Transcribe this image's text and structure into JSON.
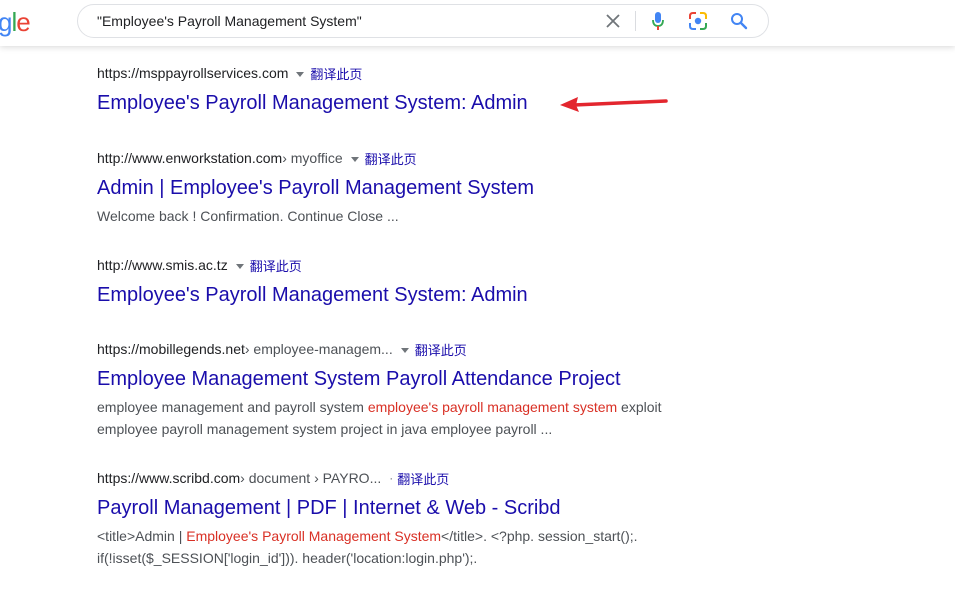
{
  "search": {
    "query": "\"Employee's Payroll Management System\""
  },
  "logo": {
    "visible_text": [
      "g",
      "l",
      "e"
    ],
    "colors": [
      "#4285f4",
      "#34a853",
      "#ea4335"
    ]
  },
  "icons": {
    "clear": "close-icon",
    "voice": "microphone-icon",
    "lens": "camera-lens-icon",
    "search": "search-icon"
  },
  "translate_label": "翻译此页",
  "results": [
    {
      "url": "https://msppayrollservices.com",
      "path": "",
      "title": "Employee's Payroll Management System: Admin",
      "snippet": []
    },
    {
      "url": "http://www.enworkstation.com",
      "path": " › myoffice",
      "title": "Admin | Employee's Payroll Management System",
      "snippet": [
        [
          {
            "text": "Welcome back ! Confirmation. Continue Close ...",
            "hl": false
          }
        ]
      ]
    },
    {
      "url": "http://www.smis.ac.tz",
      "path": "",
      "title": "Employee's Payroll Management System: Admin",
      "snippet": []
    },
    {
      "url": "https://mobillegends.net",
      "path": " › employee-managem...",
      "title": "Employee Management System Payroll Attendance Project",
      "snippet": [
        [
          {
            "text": "employee management and payroll system ",
            "hl": false
          },
          {
            "text": "employee's payroll management system",
            "hl": true
          },
          {
            "text": " exploit",
            "hl": false
          }
        ],
        [
          {
            "text": "employee payroll management system project in java employee payroll ...",
            "hl": false
          }
        ]
      ]
    },
    {
      "url": "https://www.scribd.com",
      "path": " › document › PAYRO...",
      "title": "Payroll Management | PDF | Internet & Web - Scribd",
      "snippet": [
        [
          {
            "text": "<title>Admin | ",
            "hl": false
          },
          {
            "text": "Employee's Payroll Management System",
            "hl": true
          },
          {
            "text": "</title>. <?php. session_start();.",
            "hl": false
          }
        ],
        [
          {
            "text": "if(!isset($_SESSION['login_id'])). header('location:login.php');.",
            "hl": false
          }
        ]
      ]
    }
  ],
  "colors": {
    "link": "#1a0dab",
    "highlight": "#d93025",
    "annotation_arrow": "#e3262e"
  }
}
